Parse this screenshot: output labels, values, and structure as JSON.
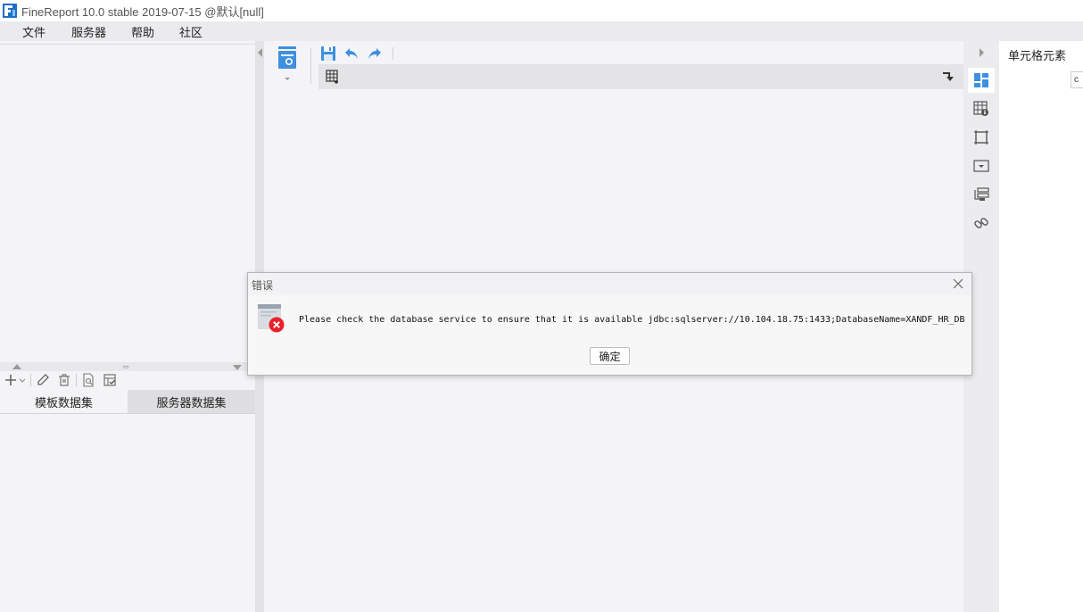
{
  "window": {
    "title": "FineReport 10.0 stable 2019-07-15 @默认[null]",
    "logo_icon": "finereport-logo-icon"
  },
  "menubar": {
    "items": [
      "文件",
      "服务器",
      "帮助",
      "社区"
    ]
  },
  "left_panel": {
    "dataset_toolbar_icons": [
      "add-icon",
      "edit-icon",
      "delete-icon",
      "preview-icon",
      "server-dataset-icon"
    ],
    "tabs": [
      {
        "label": "模板数据集",
        "active": true
      },
      {
        "label": "服务器数据集",
        "active": false
      }
    ]
  },
  "center": {
    "toolbar_icons": [
      "template-icon",
      "save-icon",
      "undo-icon",
      "redo-icon"
    ],
    "sheet_icons": [
      "sheet-grid-icon",
      "corner-dropdown-icon"
    ]
  },
  "right_rail": {
    "buttons": [
      "cell-element-icon",
      "cell-attribute-icon",
      "float-element-icon",
      "widget-icon",
      "condition-attribute-icon",
      "hyperlink-icon"
    ],
    "active_index": 0
  },
  "property_panel": {
    "title": "单元格元素",
    "field_value": "c"
  },
  "dialog": {
    "title": "错误",
    "message": "Please check the database service to ensure that it is available jdbc:sqlserver://10.104.18.75:1433;DatabaseName=XANDF_HR_DB",
    "ok_label": "确定",
    "icon": "error-icon",
    "colors": {
      "error": "#e8202a",
      "accent": "#3d8fe0"
    }
  }
}
